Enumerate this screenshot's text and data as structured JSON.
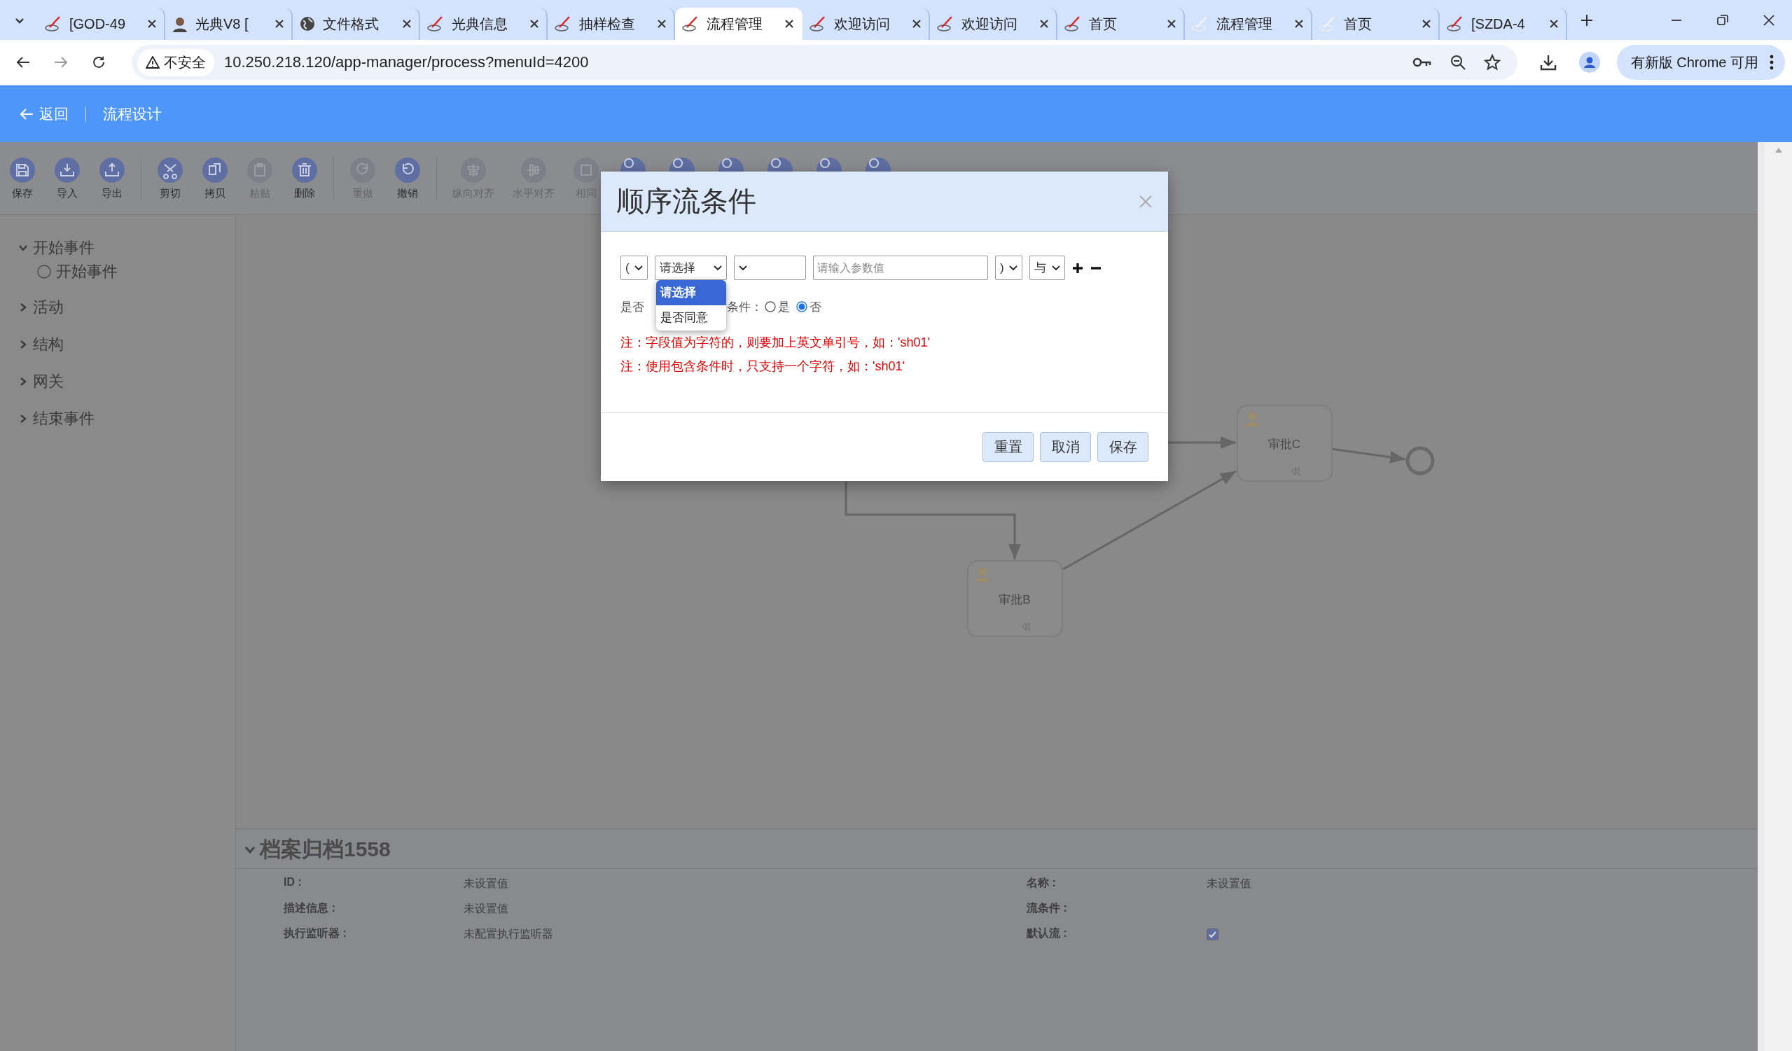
{
  "browser": {
    "tabs": [
      {
        "label": "[GOD-49",
        "kind": "swoosh",
        "selected": false
      },
      {
        "label": "光典V8 [",
        "kind": "person",
        "selected": false
      },
      {
        "label": "文件格式",
        "kind": "globe",
        "selected": false
      },
      {
        "label": "光典信息",
        "kind": "swoosh",
        "selected": false
      },
      {
        "label": "抽样检查",
        "kind": "swoosh",
        "selected": false
      },
      {
        "label": "流程管理",
        "kind": "swoosh",
        "selected": true
      },
      {
        "label": "欢迎访问",
        "kind": "swoosh",
        "selected": false
      },
      {
        "label": "欢迎访问",
        "kind": "swoosh",
        "selected": false
      },
      {
        "label": "首页",
        "kind": "swoosh",
        "selected": false
      },
      {
        "label": "流程管理",
        "kind": "faint",
        "selected": false
      },
      {
        "label": "首页",
        "kind": "faint",
        "selected": false
      },
      {
        "label": "[SZDA-4",
        "kind": "swoosh",
        "selected": false
      }
    ],
    "security": "不安全",
    "url": "10.250.218.120/app-manager/process?menuId=4200",
    "update_button": "有新版 Chrome 可用"
  },
  "header": {
    "back": "返回",
    "title": "流程设计"
  },
  "toolbar": [
    {
      "kind": "button",
      "label": "保存",
      "disabled": false
    },
    {
      "kind": "button",
      "label": "导入",
      "disabled": false
    },
    {
      "kind": "button",
      "label": "导出",
      "disabled": false
    },
    {
      "kind": "separator"
    },
    {
      "kind": "button",
      "label": "剪切",
      "disabled": false
    },
    {
      "kind": "button",
      "label": "拷贝",
      "disabled": false
    },
    {
      "kind": "button",
      "label": "粘贴",
      "disabled": true
    },
    {
      "kind": "button",
      "label": "删除",
      "disabled": false
    },
    {
      "kind": "separator"
    },
    {
      "kind": "button",
      "label": "重做",
      "disabled": true
    },
    {
      "kind": "button",
      "label": "撤销",
      "disabled": false
    },
    {
      "kind": "separator"
    },
    {
      "kind": "button",
      "label": "纵向对齐",
      "disabled": true
    },
    {
      "kind": "button",
      "label": "水平对齐",
      "disabled": true
    },
    {
      "kind": "button",
      "label": "相同",
      "disabled": true
    },
    {
      "kind": "icon"
    },
    {
      "kind": "icon"
    },
    {
      "kind": "icon"
    },
    {
      "kind": "icon"
    },
    {
      "kind": "icon"
    },
    {
      "kind": "icon"
    }
  ],
  "palette": [
    {
      "label": "开始事件",
      "expanded": true,
      "children": [
        {
          "label": "开始事件"
        }
      ]
    },
    {
      "label": "活动",
      "expanded": false
    },
    {
      "label": "结构",
      "expanded": false
    },
    {
      "label": "网关",
      "expanded": false
    },
    {
      "label": "结束事件",
      "expanded": false
    }
  ],
  "diagram": {
    "nodes": [
      {
        "kind": "task",
        "label": "审批C"
      },
      {
        "kind": "task",
        "label": "审批B"
      },
      {
        "kind": "end"
      }
    ]
  },
  "properties": {
    "title": "档案归档1558",
    "expanded": true,
    "fields": [
      {
        "kind": "text",
        "label": "ID :",
        "value": "未设置值"
      },
      {
        "kind": "text",
        "label": "名称 :",
        "value": "未设置值"
      },
      {
        "kind": "text",
        "label": "描述信息 :",
        "value": "未设置值"
      },
      {
        "kind": "text",
        "label": "流条件 :"
      },
      {
        "kind": "text",
        "label": "执行监听器 :",
        "value": "未配置执行监听器"
      },
      {
        "kind": "checkbox",
        "label": "默认流 :",
        "checked": true
      }
    ]
  },
  "dialog": {
    "title": "顺序流条件",
    "controls": [
      {
        "kind": "select",
        "value": "("
      },
      {
        "kind": "select",
        "value": "请选择",
        "expanded": true,
        "options": [
          {
            "label": "请选择",
            "selected": true
          },
          {
            "label": "是否同意",
            "selected": false
          }
        ]
      },
      {
        "kind": "select"
      },
      {
        "kind": "input",
        "placeholder": "请输入参数值"
      },
      {
        "kind": "select",
        "value": ")"
      },
      {
        "kind": "select",
        "value": "与"
      }
    ],
    "radio_label_start": "是否",
    "radio_label_end": "条件：",
    "radio_options": [
      {
        "label": "是",
        "selected": false
      },
      {
        "label": "否",
        "selected": true
      }
    ],
    "notes": [
      "注：字段值为字符的，则要加上英文单引号，如：'sh01'",
      "注：使用包含条件时，只支持一个字符，如：'sh01'"
    ],
    "buttons": [
      "重置",
      "取消",
      "保存"
    ]
  }
}
